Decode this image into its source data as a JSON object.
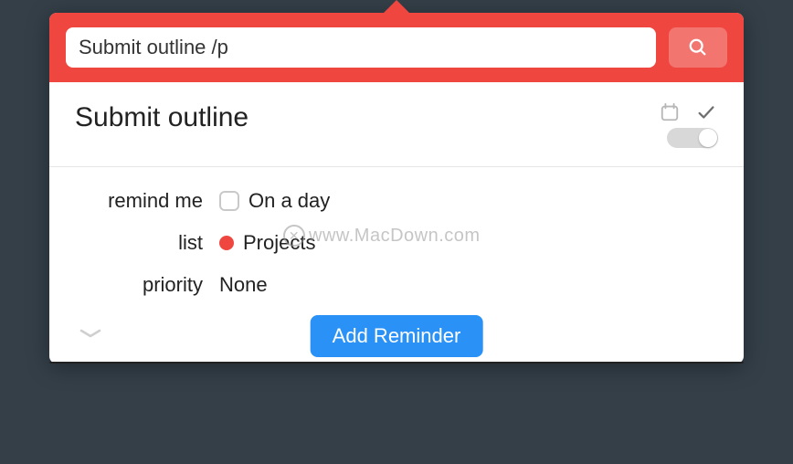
{
  "header": {
    "search_value": "Submit outline /p"
  },
  "task": {
    "title": "Submit outline"
  },
  "fields": {
    "remind_label": "remind me",
    "remind_value": "On a day",
    "list_label": "list",
    "list_value": "Projects",
    "list_color": "#ef473f",
    "priority_label": "priority",
    "priority_value": "None"
  },
  "actions": {
    "add_button": "Add Reminder"
  },
  "watermark": "www.MacDown.com"
}
